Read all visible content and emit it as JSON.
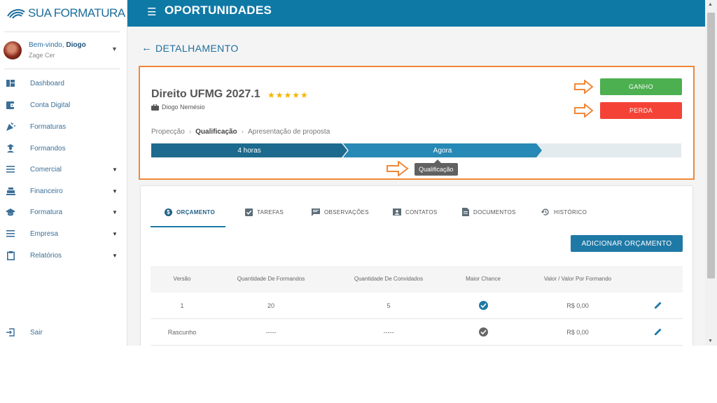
{
  "sidebar": {
    "logo": "SUA FORMATURA",
    "user": {
      "welcome": "Bem-vindo, ",
      "name": "Diogo",
      "org": "Zage Cer"
    },
    "items": [
      {
        "label": "Dashboard",
        "icon": "dashboard-icon",
        "has_caret": false
      },
      {
        "label": "Conta Digital",
        "icon": "wallet-icon",
        "has_caret": false
      },
      {
        "label": "Formaturas",
        "icon": "party-icon",
        "has_caret": false
      },
      {
        "label": "Formandos",
        "icon": "graduate-icon",
        "has_caret": false
      },
      {
        "label": "Comercial",
        "icon": "menu-icon",
        "has_caret": true
      },
      {
        "label": "Financeiro",
        "icon": "cash-register-icon",
        "has_caret": true
      },
      {
        "label": "Formatura",
        "icon": "mortarboard-icon",
        "has_caret": true
      },
      {
        "label": "Empresa",
        "icon": "menu-icon",
        "has_caret": true
      },
      {
        "label": "Relatórios",
        "icon": "clipboard-icon",
        "has_caret": true
      }
    ],
    "logout": "Sair"
  },
  "header": {
    "title": "OPORTUNIDADES"
  },
  "page": {
    "title": "DETALHAMENTO"
  },
  "deal": {
    "title": "Direito UFMG 2027.1",
    "stars": "★★★★★",
    "owner": "Diogo Nemésio",
    "breadcrumb": [
      "Propecção",
      "Qualificação",
      "Apresentação de proposta"
    ],
    "stages": [
      {
        "label": "4 horas"
      },
      {
        "label": "Agora"
      }
    ],
    "tooltip": "Qualificação",
    "won_label": "GANHO",
    "lost_label": "PERDA"
  },
  "tabs": [
    {
      "label": "ORÇAMENTO",
      "icon": "dollar-icon",
      "active": true
    },
    {
      "label": "TAREFAS",
      "icon": "checkbox-icon",
      "active": false
    },
    {
      "label": "OBSERVAÇÕES",
      "icon": "comment-icon",
      "active": false
    },
    {
      "label": "CONTATOS",
      "icon": "contacts-icon",
      "active": false
    },
    {
      "label": "DOCUMENTOS",
      "icon": "document-icon",
      "active": false
    },
    {
      "label": "HISTÓRICO",
      "icon": "history-icon",
      "active": false
    }
  ],
  "add_budget_label": "ADICIONAR ORÇAMENTO",
  "table": {
    "columns": [
      "Versão",
      "Quantidade De Formandos",
      "Quantidade De Convidados",
      "Maior Chance",
      "Valor / Valor Por Formando"
    ],
    "rows": [
      {
        "version": "1",
        "graduates": "20",
        "guests": "5",
        "best_chance": true,
        "value": "R$ 0,00"
      },
      {
        "version": "Rascunho",
        "graduates": "-----",
        "guests": "-----",
        "best_chance": false,
        "value": "R$ 0,00"
      }
    ]
  },
  "colors": {
    "primary": "#0f79a6",
    "won": "#4caf50",
    "lost": "#f44336",
    "highlight": "#f0883a",
    "stars": "#f5b400"
  }
}
